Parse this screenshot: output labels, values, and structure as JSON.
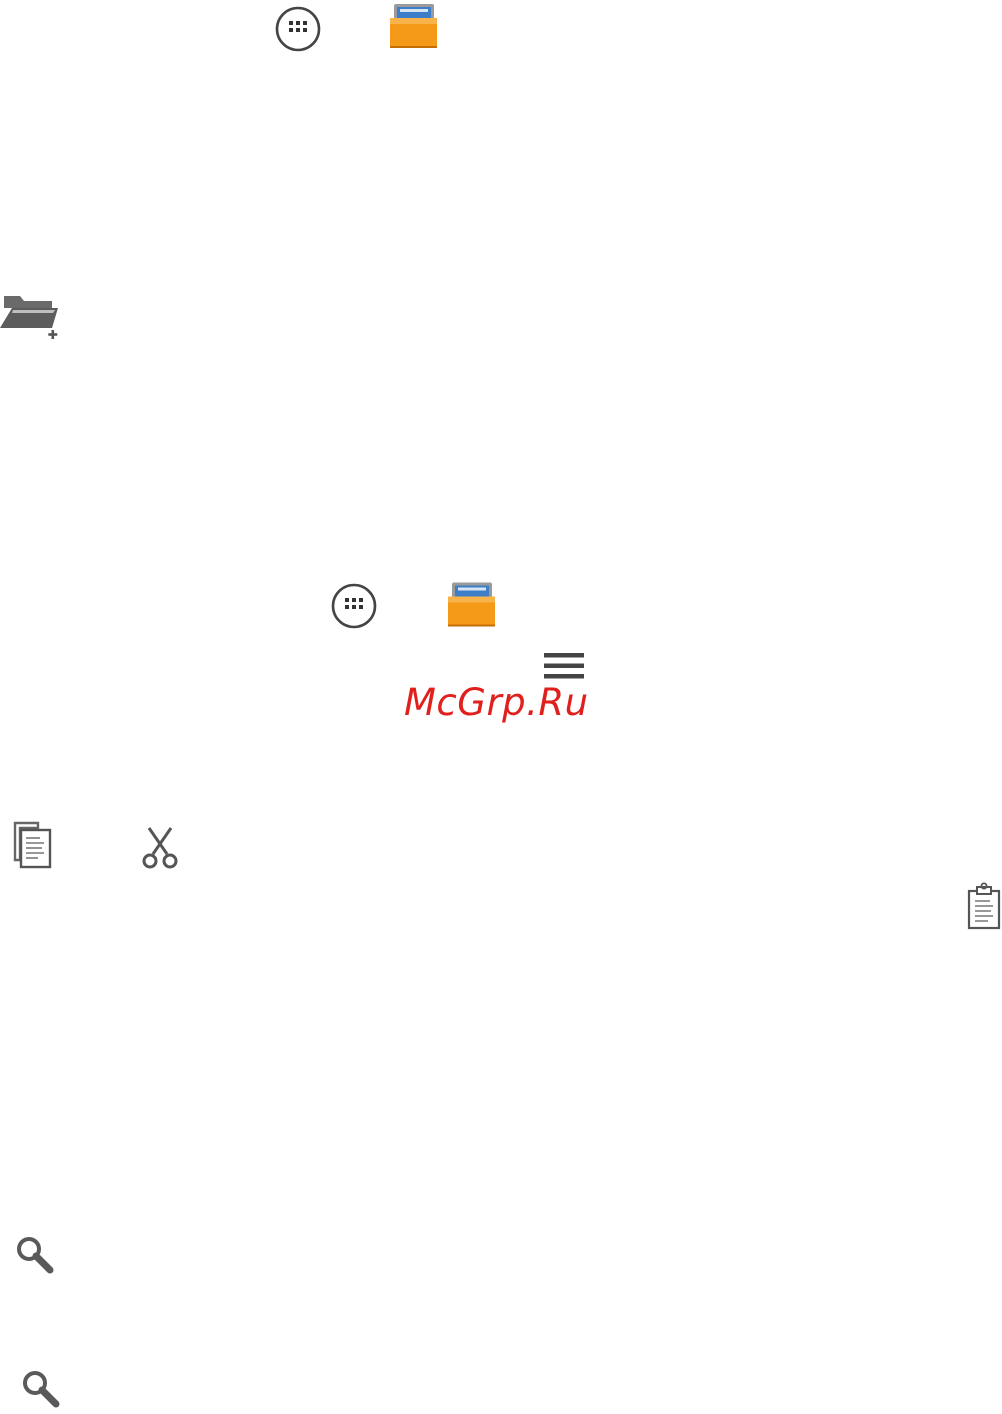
{
  "icons": {
    "apps": "apps-grid-icon",
    "gallery": "gallery-folder-icon",
    "new_folder": "new-folder-icon",
    "menu": "menu-icon",
    "copy": "copy-icon",
    "cut": "scissors-icon",
    "paste": "clipboard-icon",
    "search": "search-icon"
  },
  "watermark": {
    "text": "McGrp.Ru"
  },
  "colors": {
    "icon_gray": "#5a5a5a",
    "folder_orange": "#f59a18",
    "watermark_red": "#e0201c"
  }
}
